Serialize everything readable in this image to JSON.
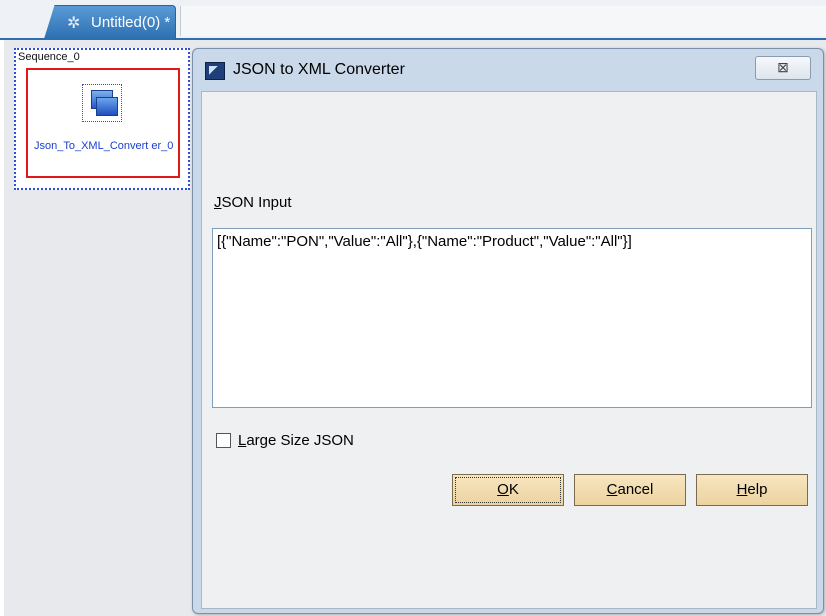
{
  "tab": {
    "label": "Untitled(0) *",
    "icon": "gear-icon"
  },
  "canvas": {
    "sequence_label": "Sequence_0",
    "activity_label": "Json_To_XML_Convert er_0"
  },
  "dialog": {
    "title": "JSON to XML Converter",
    "close_glyph": "⊠",
    "json_label_first": "J",
    "json_label_rest": "SON Input",
    "json_value": "[{\"Name\":\"PON\",\"Value\":\"All\"},{\"Name\":\"Product\",\"Value\":\"All\"}]",
    "checkbox_label_first": "L",
    "checkbox_label_rest": "arge Size JSON",
    "checkbox_checked": false,
    "ok_first": "O",
    "ok_rest": "K",
    "cancel_first": "C",
    "cancel_rest": "ancel",
    "help_first": "H",
    "help_rest": "elp"
  },
  "colors": {
    "tab_accent": "#2d6fb0",
    "selection_border": "#e01818",
    "sequence_border": "#2c4fd6",
    "button_face": "#ecd3a0"
  }
}
